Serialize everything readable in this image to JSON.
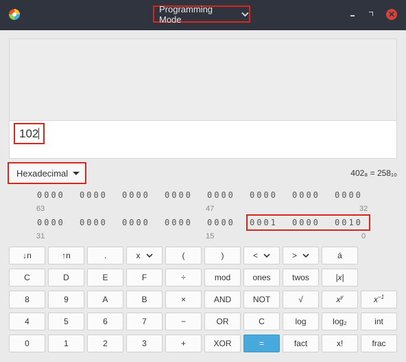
{
  "titlebar": {
    "mode_label": "Programming Mode",
    "accent_close": "#d9423b"
  },
  "display": {
    "entry_value": "102"
  },
  "base_selector": {
    "selected": "Hexadecimal"
  },
  "conversion_text": "402₈ = 258₁₀",
  "bits": {
    "row1": [
      "0000",
      "0000",
      "0000",
      "0000",
      "0000",
      "0000",
      "0000",
      "0000"
    ],
    "row1_labels": [
      "63",
      "47",
      "32"
    ],
    "row2": [
      "0000",
      "0000",
      "0000",
      "0000",
      "0000",
      "0001",
      "0000",
      "0010"
    ],
    "row2_labels": [
      "31",
      "15",
      "0"
    ]
  },
  "keys": {
    "r1": [
      "↓n",
      "↑n",
      ".",
      "x",
      "(",
      ")",
      "<",
      ">",
      "á"
    ],
    "r2": [
      "C",
      "D",
      "E",
      "F",
      "÷",
      "mod",
      "ones",
      "twos",
      "|x|"
    ],
    "r3": [
      "8",
      "9",
      "A",
      "B",
      "×",
      "AND",
      "NOT",
      "√",
      "x^y",
      "x^−1"
    ],
    "r4": [
      "4",
      "5",
      "6",
      "7",
      "−",
      "OR",
      "C",
      "log",
      "log₂",
      "int"
    ],
    "r5": [
      "0",
      "1",
      "2",
      "3",
      "+",
      "XOR",
      "=",
      "fact",
      "x!",
      "frac"
    ]
  },
  "colors": {
    "titlebar": "#2f343f",
    "equals": "#48a9dc",
    "highlight": "#d9261c"
  }
}
